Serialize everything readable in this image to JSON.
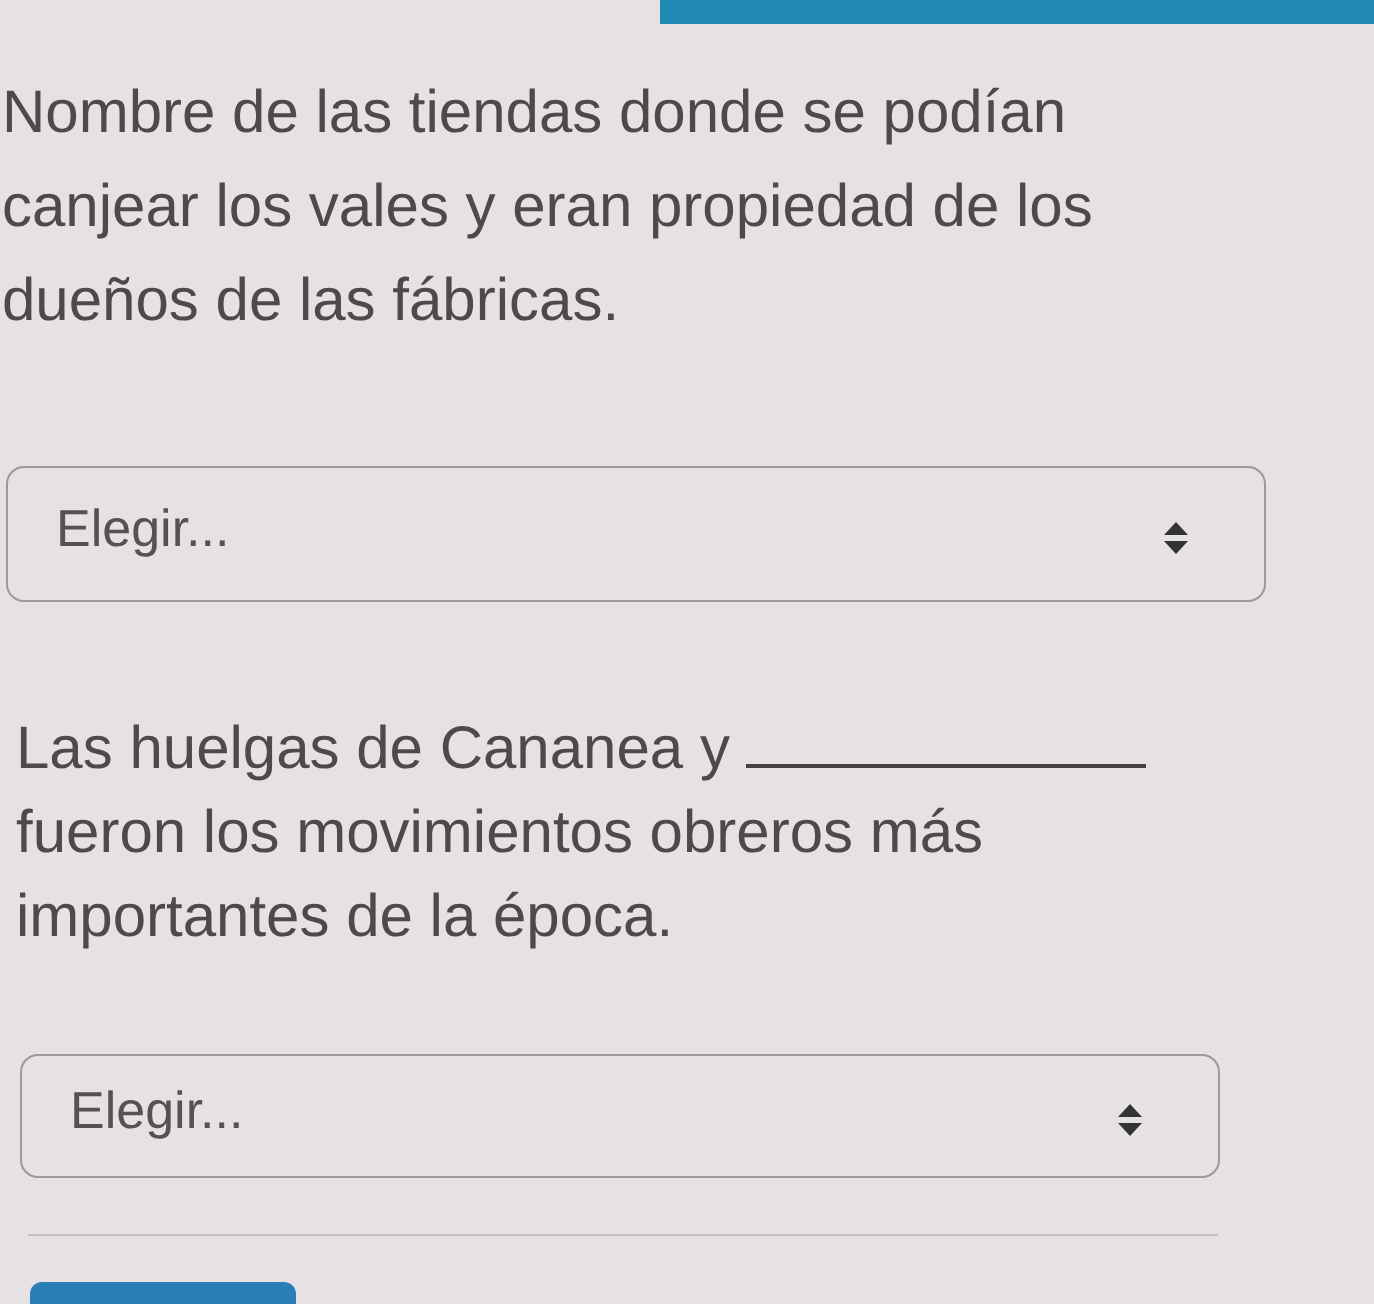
{
  "questions": [
    {
      "kind": "text",
      "prompt": "Nombre de las tiendas donde se podían canjear los vales y eran propiedad de los dueños de las fábricas.",
      "answer": {
        "placeholder": "Elegir..."
      }
    },
    {
      "kind": "blank",
      "prompt_before": "Las huelgas de Cananea y",
      "prompt_after": "fueron los movimientos obreros más importantes de la época.",
      "answer": {
        "placeholder": "Elegir..."
      }
    }
  ]
}
